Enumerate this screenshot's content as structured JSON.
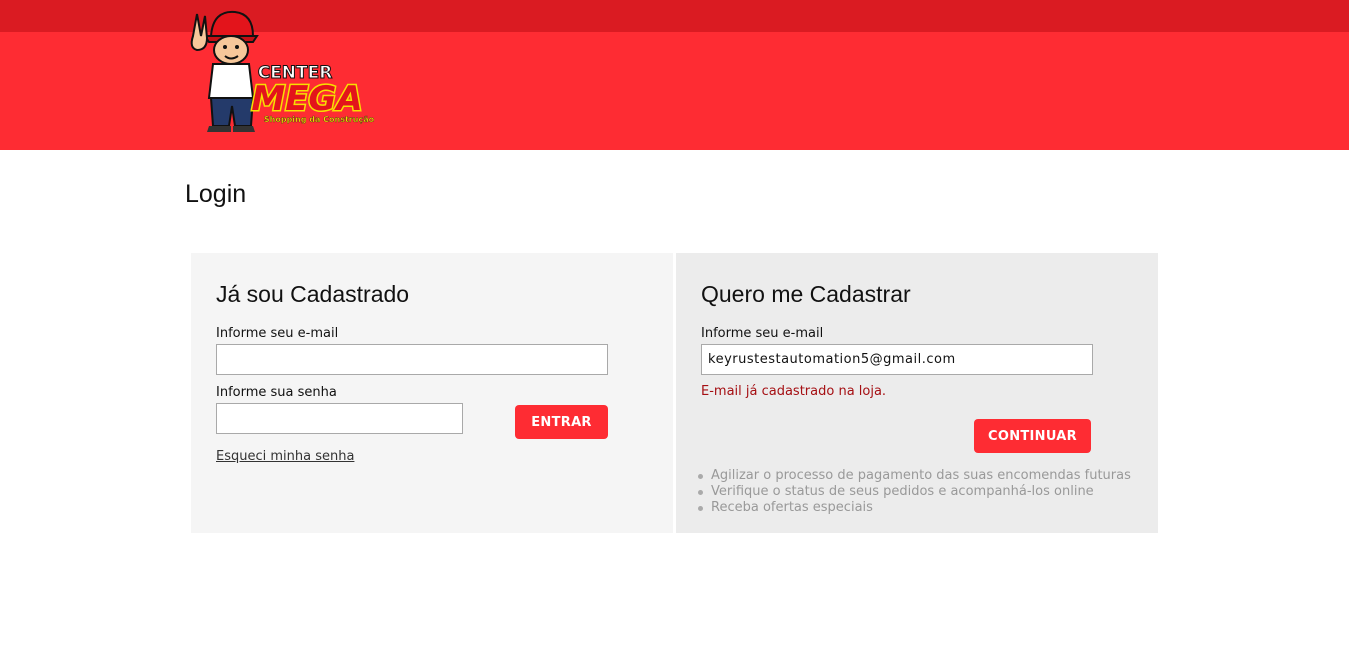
{
  "brand": {
    "logo_top": "CENTER",
    "logo_main": "MEGA",
    "logo_tagline": "Shopping da Construção",
    "colors": {
      "topbar": "#da1b22",
      "header": "#fe2c33",
      "button": "#fe2c33",
      "error": "#a50f13"
    }
  },
  "page": {
    "title": "Login"
  },
  "login": {
    "heading": "Já sou Cadastrado",
    "email_label": "Informe seu e-mail",
    "email_value": "",
    "password_label": "Informe sua senha",
    "password_value": "",
    "submit_label": "ENTRAR",
    "forgot_label": "Esqueci minha senha"
  },
  "register": {
    "heading": "Quero me Cadastrar",
    "email_label": "Informe seu e-mail",
    "email_value": "keyrustestautomation5@gmail.com",
    "error_message": "E-mail já cadastrado na loja.",
    "submit_label": "CONTINUAR",
    "benefits": [
      "Agilizar o processo de pagamento das suas encomendas futuras",
      "Verifique o status de seus pedidos e acompanhá-los online",
      "Receba ofertas especiais"
    ]
  }
}
